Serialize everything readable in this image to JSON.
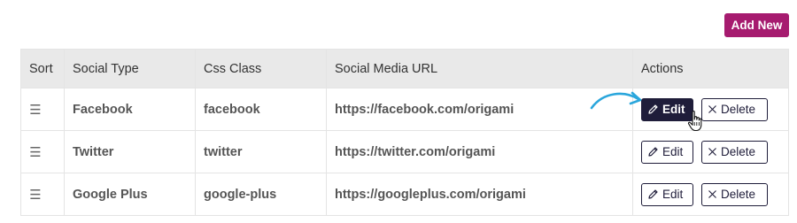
{
  "toolbar": {
    "add_new_label": "Add New"
  },
  "table": {
    "headers": {
      "sort": "Sort",
      "social_type": "Social Type",
      "css_class": "Css Class",
      "url": "Social Media URL",
      "actions": "Actions"
    },
    "rows": [
      {
        "social_type": "Facebook",
        "css_class": "facebook",
        "url": "https://facebook.com/origami",
        "edit_label": "Edit",
        "delete_label": "Delete"
      },
      {
        "social_type": "Twitter",
        "css_class": "twitter",
        "url": "https://twitter.com/origami",
        "edit_label": "Edit",
        "delete_label": "Delete"
      },
      {
        "social_type": "Google Plus",
        "css_class": "google-plus",
        "url": "https://googleplus.com/origami",
        "edit_label": "Edit",
        "delete_label": "Delete"
      }
    ]
  },
  "icons": {
    "drag_handle": "hamburger-icon",
    "edit": "pencil-icon",
    "delete": "close-icon",
    "annotation": "curved-arrow-icon",
    "pointer": "hand-cursor-icon"
  },
  "colors": {
    "accent": "#a61b6f",
    "primary_dark": "#1f1d3a",
    "header_bg": "#e9e9e9",
    "annotation_arrow": "#2aa6dc"
  }
}
